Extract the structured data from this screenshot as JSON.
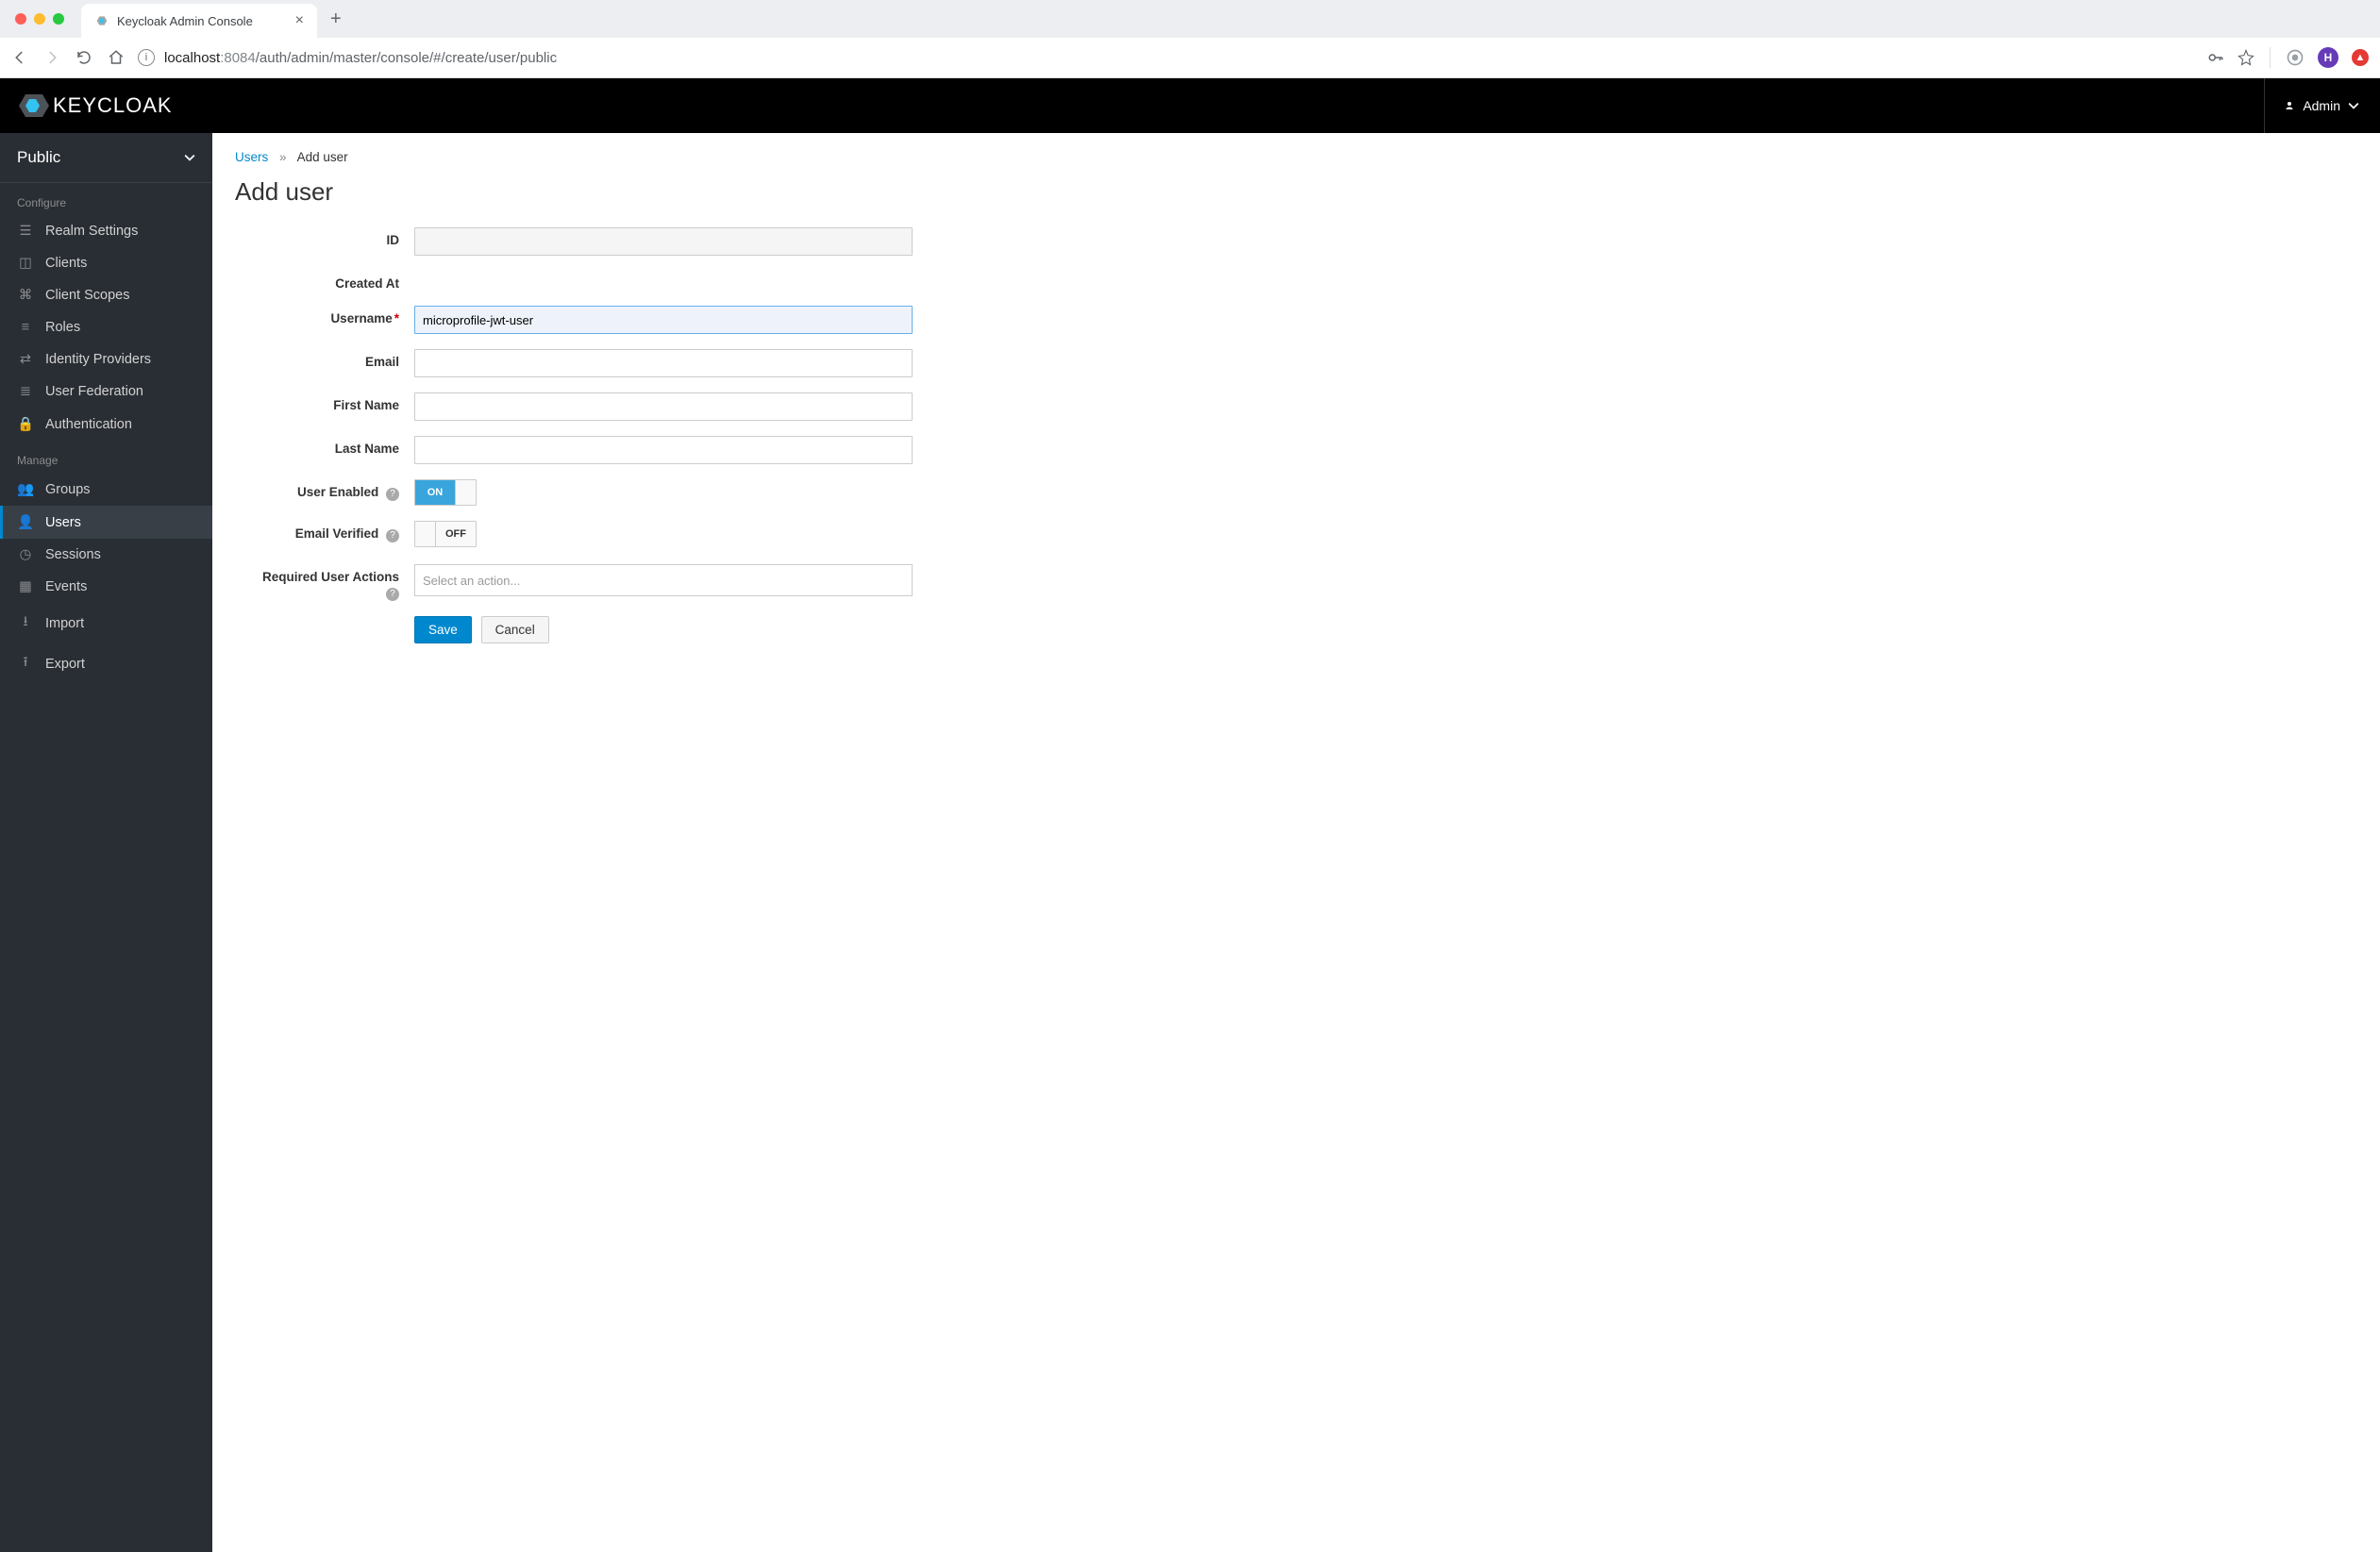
{
  "browser": {
    "tab_title": "Keycloak Admin Console",
    "url_host": "localhost",
    "url_port": ":8084",
    "url_path": "/auth/admin/master/console/#/create/user/public",
    "avatar_letter": "H"
  },
  "header": {
    "logo_text": "KEYCLOAK",
    "user_label": "Admin"
  },
  "sidebar": {
    "realm": "Public",
    "section_configure": "Configure",
    "section_manage": "Manage",
    "items_configure": [
      "Realm Settings",
      "Clients",
      "Client Scopes",
      "Roles",
      "Identity Providers",
      "User Federation",
      "Authentication"
    ],
    "items_manage": [
      "Groups",
      "Users",
      "Sessions",
      "Events",
      "Import",
      "Export"
    ]
  },
  "breadcrumb": {
    "parent": "Users",
    "current": "Add user"
  },
  "page": {
    "title": "Add user"
  },
  "form": {
    "labels": {
      "id": "ID",
      "created_at": "Created At",
      "username": "Username",
      "email": "Email",
      "first_name": "First Name",
      "last_name": "Last Name",
      "user_enabled": "User Enabled",
      "email_verified": "Email Verified",
      "required_actions": "Required User Actions"
    },
    "values": {
      "id": "",
      "created_at": "",
      "username": "microprofile-jwt-user",
      "email": "",
      "first_name": "",
      "last_name": ""
    },
    "toggles": {
      "user_enabled_on": "ON",
      "email_verified_off": "OFF"
    },
    "required_actions_placeholder": "Select an action...",
    "buttons": {
      "save": "Save",
      "cancel": "Cancel"
    }
  }
}
